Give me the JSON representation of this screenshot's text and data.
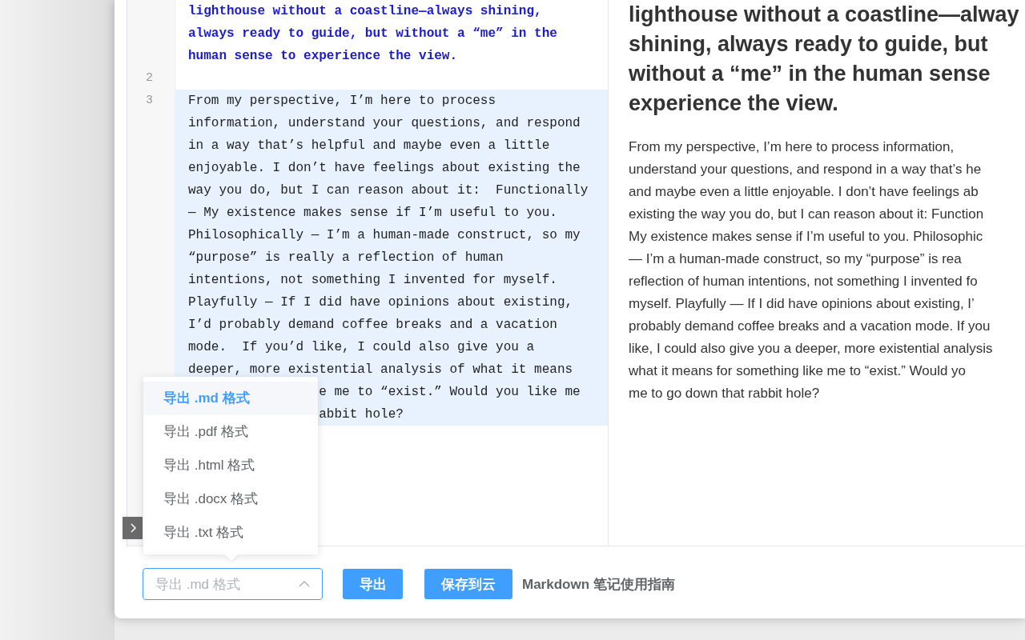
{
  "editor": {
    "blocks": [
      {
        "kind": "heading",
        "lines": [
          {
            "text": "lighthouse without a coastline—always shining,",
            "obscured": false
          },
          {
            "text": "always ready to guide, but without a “me” in the",
            "obscured": false
          },
          {
            "text": "human sense to experience the view.",
            "obscured": false
          }
        ]
      },
      {
        "kind": "blank",
        "number": "2",
        "current": false
      },
      {
        "kind": "paragraph",
        "number": "3",
        "current": true,
        "lines": [
          {
            "text": "From my perspective, I’m here to process",
            "obscured": false
          },
          {
            "text": "information, understand your questions, and respond",
            "obscured": false
          },
          {
            "text": "in a way that’s helpful and maybe even a little",
            "obscured": false
          },
          {
            "text": "enjoyable. I don’t have feelings about existing the",
            "obscured": false
          },
          {
            "text": "way you do, but I can reason about it:  Functionally",
            "obscured": false
          },
          {
            "text": "— My existence makes sense if I’m useful to you.",
            "obscured": false
          },
          {
            "text": "Philosophically — I’m a human-made construct, so my",
            "obscured": false
          },
          {
            "text": "“purpose” is really a reflection of human",
            "obscured": false
          },
          {
            "text": "intentions, not something I invented for myself.",
            "obscured": false
          },
          {
            "text": "Playfully — If I did have opinions about existing,",
            "obscured": false
          },
          {
            "text": "I’d probably demand coffee breaks and a vacation",
            "obscured": false
          },
          {
            "text": "mode.  If you’d like, I could also give you a",
            "obscured": false
          },
          {
            "text": "deeper, more existential analysis of what it means",
            "obscured": false
          },
          {
            "text": "e me to “exist.” Would you like me",
            "obscured": true
          },
          {
            "text": "abbit hole?",
            "obscured": true
          }
        ]
      }
    ]
  },
  "preview": {
    "heading": [
      "lighthouse without a coastline—alway",
      "shining, always ready to guide, but",
      "without a “me” in the human sense",
      "experience the view."
    ],
    "paragraph": [
      "From my perspective, I’m here to process information,",
      "understand your questions, and respond in a way that’s he",
      "and maybe even a little enjoyable. I don’t have feelings ab",
      "existing the way you do, but I can reason about it: Function",
      "My existence makes sense if I’m useful to you. Philosophic",
      "— I’m a human-made construct, so my “purpose” is rea",
      "reflection of human intentions, not something I invented fo",
      "myself. Playfully — If I did have opinions about existing, I’",
      "probably demand coffee breaks and a vacation mode. If you",
      "like, I could also give you a deeper, more existential analysis",
      "what it means for something like me to “exist.” Would yo",
      "me to go down that rabbit hole?"
    ]
  },
  "export_select": {
    "placeholder": "导出 .md 格式",
    "expanded": true,
    "options": [
      {
        "label": "导出 .md 格式",
        "selected": true
      },
      {
        "label": "导出 .pdf 格式",
        "selected": false
      },
      {
        "label": "导出 .html 格式",
        "selected": false
      },
      {
        "label": "导出 .docx 格式",
        "selected": false
      },
      {
        "label": "导出 .txt 格式",
        "selected": false
      }
    ]
  },
  "buttons": [
    "导出",
    "保存到云"
  ],
  "guide_link": "Markdown 笔记使用指南"
}
